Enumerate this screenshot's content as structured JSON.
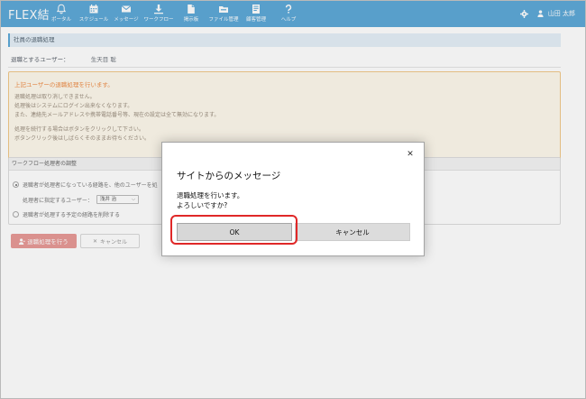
{
  "app": {
    "logo": "FLEX結"
  },
  "nav": [
    {
      "label": "ポータル",
      "icon": "bell-icon"
    },
    {
      "label": "スケジュール",
      "icon": "calendar-icon"
    },
    {
      "label": "メッセージ",
      "icon": "envelope-icon"
    },
    {
      "label": "ワークフロー",
      "icon": "workflow-icon"
    },
    {
      "label": "掲示板",
      "icon": "document-icon"
    },
    {
      "label": "ファイル管理",
      "icon": "folder-icon"
    },
    {
      "label": "顧客管理",
      "icon": "customer-book-icon"
    },
    {
      "label": "ヘルプ",
      "icon": "question-icon"
    }
  ],
  "user": {
    "name": "山田 太郎",
    "settings_icon": "gear-icon",
    "avatar_icon": "person-icon"
  },
  "page": {
    "section_title": "社員の退職処理",
    "target_label": "退職とするユーザー：",
    "target_name": "生天目 聡",
    "warning": {
      "title": "上記ユーザーの退職処理を行います。",
      "lines": [
        "退職処理は取り消しできません。",
        "処理後はシステムにログイン出来なくなります。",
        "また、連絡先メールアドレスや携帯電話番号等、現在の設定は全て無効になります。",
        "処理を続行する場合はボタンをクリックして下さい。",
        "ボタンクリック後はしばらくそのままお待ちください。"
      ]
    },
    "workflow": {
      "heading": "ワークフロー処理者の調整",
      "option1": "退職者が処理者になっている経路を、他のユーザーを処",
      "assign_label": "処理者に指定するユーザー：",
      "assign_value": "浅井 治",
      "option2": "退職者が処理する予定の経路を削除する"
    },
    "retire_button": "退職処理を行う",
    "cancel_button": "キャンセル"
  },
  "dialog": {
    "title": "サイトからのメッセージ",
    "message_line1": "退職処理を行います。",
    "message_line2": "よろしいですか?",
    "ok_label": "OK",
    "cancel_label": "キャンセル",
    "close_glyph": "✕"
  },
  "colors": {
    "header": "#5ea9d8",
    "warning_text": "#ef8e4a",
    "warning_bg": "#fef9ec",
    "retire_button": "#e89b97",
    "highlight_ring": "#e02828"
  }
}
